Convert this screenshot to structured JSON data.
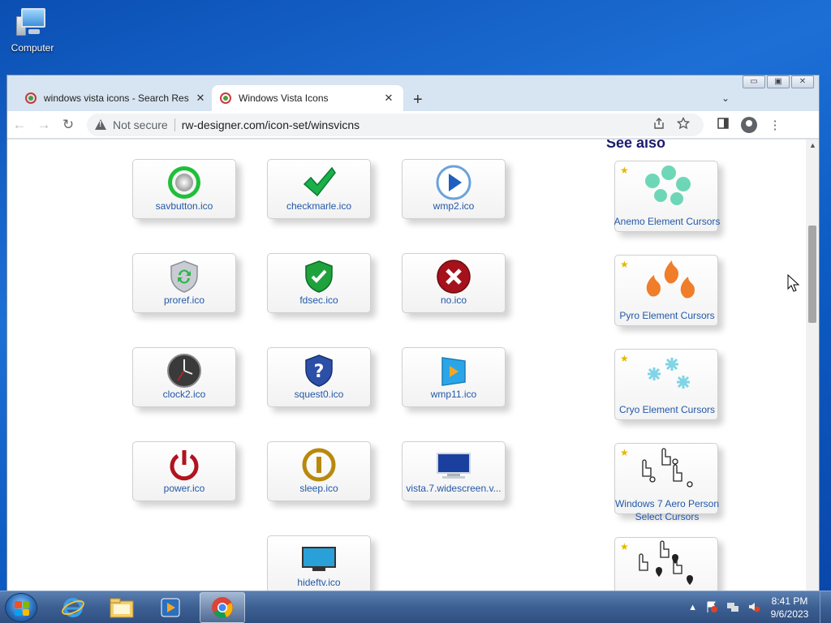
{
  "desktop": {
    "computer_label": "Computer"
  },
  "browser": {
    "tabs": [
      {
        "title": "windows vista icons - Search Res",
        "active": false
      },
      {
        "title": "Windows Vista Icons",
        "active": true
      }
    ],
    "new_tab_glyph": "+",
    "tab_search_glyph": "⌄",
    "close_glyph": "✕",
    "nav": {
      "back": "←",
      "forward": "→",
      "reload": "↻"
    },
    "security_label": "Not secure",
    "url": "rw-designer.com/icon-set/winsvicns",
    "caption": {
      "minimize": "▭",
      "maximize": "▣",
      "close": "✕"
    }
  },
  "page": {
    "see_also_heading": "See also",
    "icons": [
      {
        "label": "savbutton.ico",
        "icon": "green-ring-button-icon"
      },
      {
        "label": "checkmarle.ico",
        "icon": "green-checkmark-icon"
      },
      {
        "label": "wmp2.ico",
        "icon": "play-button-icon"
      },
      {
        "label": "proref.ico",
        "icon": "refresh-shield-icon"
      },
      {
        "label": "fdsec.ico",
        "icon": "green-shield-check-icon"
      },
      {
        "label": "no.ico",
        "icon": "red-x-icon"
      },
      {
        "label": "clock2.ico",
        "icon": "clock-icon"
      },
      {
        "label": "squest0.ico",
        "icon": "question-shield-icon"
      },
      {
        "label": "wmp11.ico",
        "icon": "media-player-icon"
      },
      {
        "label": "power.ico",
        "icon": "power-icon"
      },
      {
        "label": "sleep.ico",
        "icon": "sleep-icon"
      },
      {
        "label": "vista.7.widescreen.v...",
        "icon": "widescreen-monitor-icon"
      },
      {
        "label": "hideftv.ico",
        "icon": "hdtv-icon"
      }
    ],
    "see_also": [
      {
        "label": "Anemo Element Cursors",
        "color": "#5fd3b0"
      },
      {
        "label": "Pyro Element Cursors",
        "color": "#f07d2a"
      },
      {
        "label": "Cryo Element Cursors",
        "color": "#7fd4e6"
      },
      {
        "label": "Windows 7 Aero Person Select Cursors",
        "color": "#222222"
      },
      {
        "label": "",
        "color": "#222222"
      }
    ]
  },
  "taskbar": {
    "time": "8:41 PM",
    "date": "9/6/2023",
    "show_hidden_glyph": "▲"
  }
}
